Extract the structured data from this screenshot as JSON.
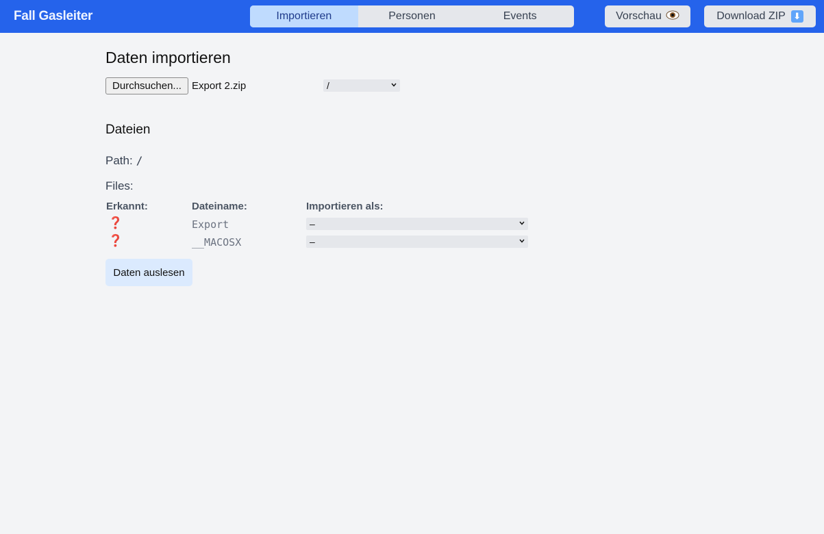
{
  "app": {
    "title": "Fall Gasleiter"
  },
  "nav": {
    "tabs": [
      {
        "label": "Importieren",
        "active": true
      },
      {
        "label": "Personen",
        "active": false
      },
      {
        "label": "Events",
        "active": false
      }
    ],
    "preview_label": "Vorschau",
    "preview_icon": "eye-icon",
    "download_label": "Download ZIP",
    "download_icon": "down-arrow-icon"
  },
  "import": {
    "heading": "Daten importieren",
    "browse_label": "Durchsuchen...",
    "file_name": "Export 2.zip",
    "root_select_value": "/"
  },
  "files_section": {
    "heading": "Dateien",
    "path_label": "Path:",
    "path_value": "/",
    "files_label": "Files:",
    "columns": [
      "Erkannt:",
      "Dateiname:",
      "Importieren als:"
    ],
    "rows": [
      {
        "recognized": "❓",
        "name": "Export",
        "import_as": "–"
      },
      {
        "recognized": "❓",
        "name": "__MACOSX",
        "import_as": "–"
      }
    ]
  },
  "actions": {
    "read_label": "Daten auslesen"
  },
  "colors": {
    "topbar": "#2563eb",
    "active_tab": "#bfdbfe",
    "primary_button": "#dbeafe",
    "unknown_mark": "#dc2626"
  }
}
